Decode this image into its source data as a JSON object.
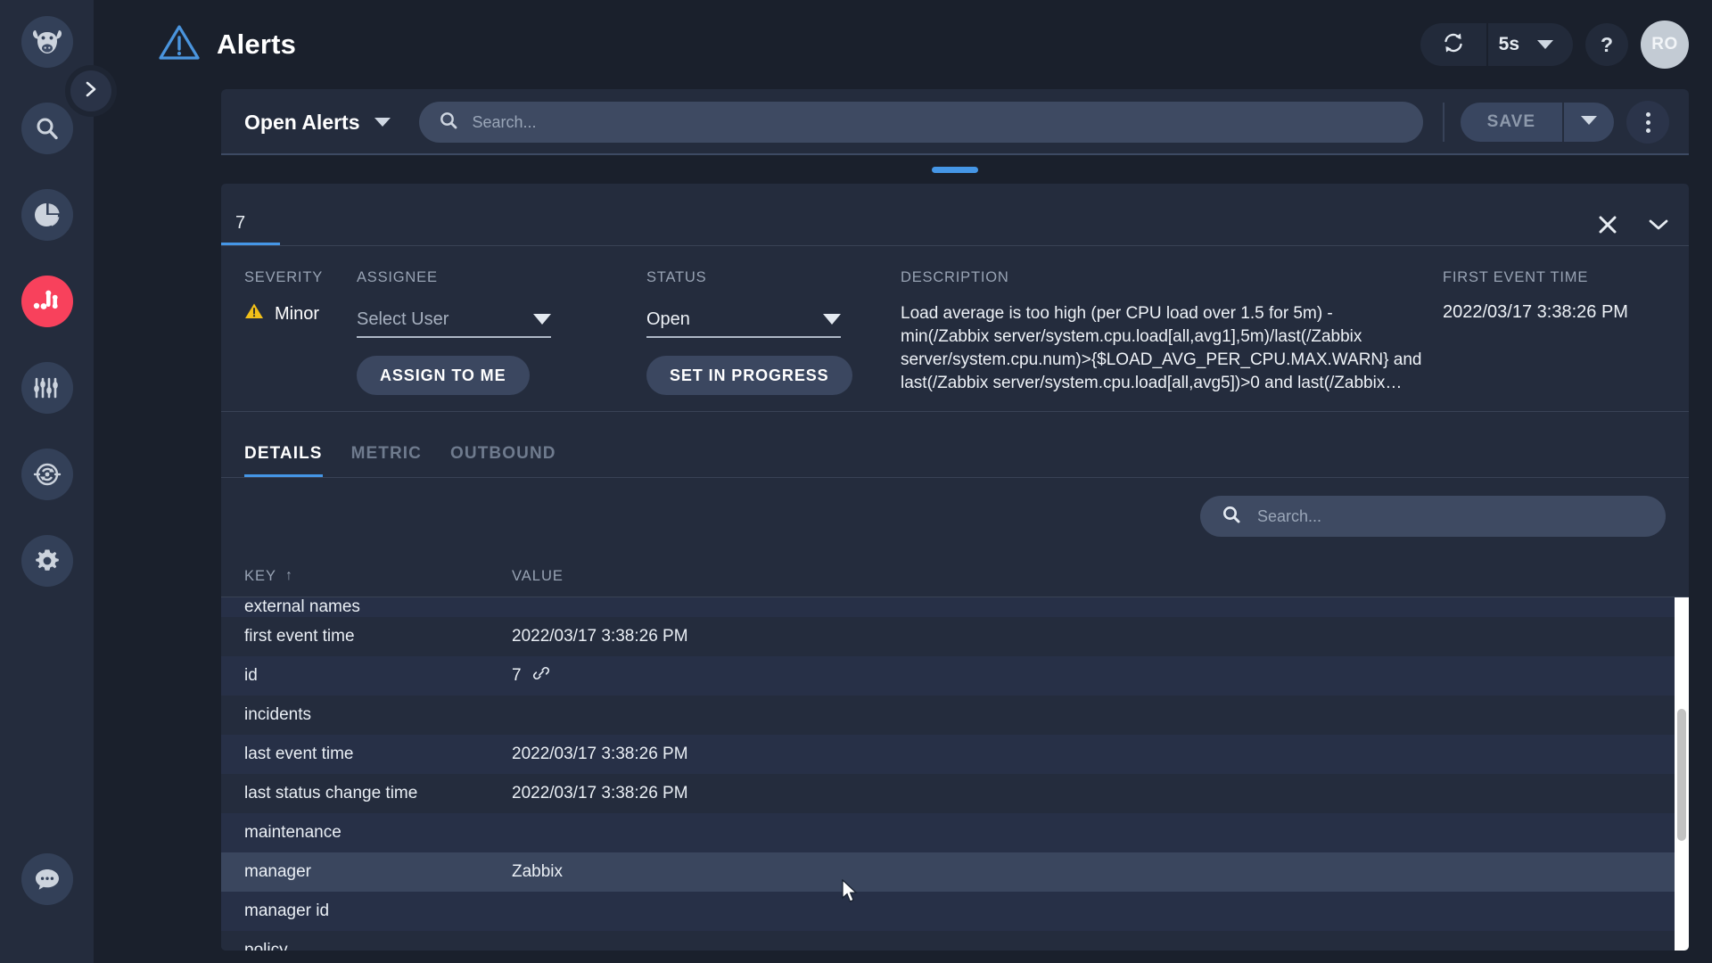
{
  "sidebar": {
    "items": [
      {
        "name": "cow-logo-icon",
        "label": "Home"
      },
      {
        "name": "search-icon",
        "label": "Search"
      },
      {
        "name": "pie-chart-icon",
        "label": "Dashboards"
      },
      {
        "name": "alerts-icon",
        "label": "Alerts",
        "active": true
      },
      {
        "name": "sliders-icon",
        "label": "Metrics"
      },
      {
        "name": "sync-icon",
        "label": "Integrations"
      },
      {
        "name": "gear-icon",
        "label": "Settings"
      },
      {
        "name": "chat-icon",
        "label": "Chat"
      }
    ],
    "expand_label": "Expand navigation"
  },
  "header": {
    "title": "Alerts",
    "warning_icon": "alert-triangle-icon",
    "refresh_icon": "refresh-icon",
    "refresh_interval": "5s",
    "help_label": "?",
    "avatar_initials": "RO"
  },
  "filterbar": {
    "view_name": "Open Alerts",
    "search_placeholder": "Search...",
    "search_value": "",
    "save_label": "SAVE",
    "more_label": "More options"
  },
  "detail": {
    "tab_label": "7",
    "close_label": "Close",
    "collapse_label": "Collapse",
    "severity": {
      "label": "SEVERITY",
      "value": "Minor",
      "color": "#f2c019"
    },
    "assignee": {
      "label": "ASSIGNEE",
      "value": "Select User",
      "button": "ASSIGN TO ME"
    },
    "status": {
      "label": "STATUS",
      "value": "Open",
      "button": "SET IN PROGRESS"
    },
    "description": {
      "label": "DESCRIPTION",
      "text": "Load average is too high (per CPU load over 1.5 for 5m) - min(/Zabbix server/system.cpu.load[all,avg1],5m)/last(/Zabbix server/system.cpu.num)>{$LOAD_AVG_PER_CPU.MAX.WARN} and last(/Zabbix server/system.cpu.load[all,avg5])>0 and last(/Zabbix…"
    },
    "first_event": {
      "label": "FIRST EVENT TIME",
      "value": "2022/03/17 3:38:26 PM"
    },
    "subtabs": [
      {
        "label": "DETAILS",
        "active": true
      },
      {
        "label": "METRIC",
        "active": false
      },
      {
        "label": "OUTBOUND",
        "active": false
      }
    ],
    "table_search_placeholder": "Search...",
    "table": {
      "columns": [
        "KEY",
        "VALUE"
      ],
      "sort": "asc",
      "partial_top_row": {
        "key": "external names",
        "value": ""
      },
      "rows": [
        {
          "key": "first event time",
          "value": "2022/03/17 3:38:26 PM"
        },
        {
          "key": "id",
          "value": "7",
          "link": true
        },
        {
          "key": "incidents",
          "value": ""
        },
        {
          "key": "last event time",
          "value": "2022/03/17 3:38:26 PM"
        },
        {
          "key": "last status change time",
          "value": "2022/03/17 3:38:26 PM"
        },
        {
          "key": "maintenance",
          "value": ""
        },
        {
          "key": "manager",
          "value": "Zabbix",
          "hovered": true
        },
        {
          "key": "manager id",
          "value": ""
        },
        {
          "key": "policy",
          "value": ""
        }
      ]
    }
  },
  "colors": {
    "accent": "#4596e6",
    "active_nav": "#f8415c",
    "panel": "#242c3d",
    "page": "#1a202c",
    "severity_minor": "#f2c019"
  }
}
